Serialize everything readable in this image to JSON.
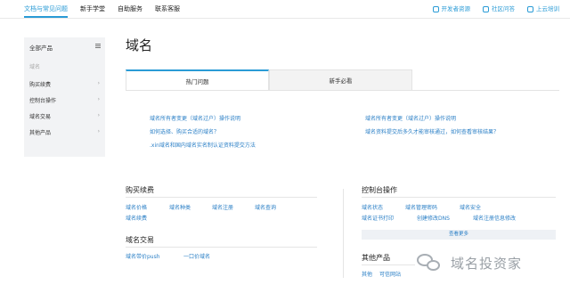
{
  "topbar": {
    "nav": [
      {
        "label": "文档与常见问题",
        "active": true
      },
      {
        "label": "新手学堂",
        "active": false
      },
      {
        "label": "自助服务",
        "active": false
      },
      {
        "label": "联系客服",
        "active": false
      }
    ],
    "links": [
      {
        "label": "开发者资源",
        "icon": "code-icon"
      },
      {
        "label": "社区问答",
        "icon": "chat-icon"
      },
      {
        "label": "上云培训",
        "icon": "training-icon"
      }
    ]
  },
  "sidebar": {
    "header": "全部产品",
    "sub": "域名",
    "items": [
      {
        "label": "购买续费"
      },
      {
        "label": "控制台操作"
      },
      {
        "label": "域名交易"
      },
      {
        "label": "其他产品"
      }
    ],
    "chevron": "›"
  },
  "main": {
    "title": "域名",
    "tabs": [
      {
        "label": "热门问题",
        "active": true
      },
      {
        "label": "新手必看",
        "active": false
      }
    ],
    "questions": {
      "left": [
        "域名所有者变更（域名过户）操作说明",
        "如何选择、购买合适的域名？",
        ".xin域名和国内域名实名制认证资料提交方法"
      ],
      "right": [
        "域名所有者变更（域名过户）操作说明",
        "域名资料提交后多久才能审核通过，如何查看审核结果？"
      ]
    },
    "sections": {
      "buy": {
        "title": "购买续费",
        "links": [
          "域名价格",
          "域名种类",
          "域名注册",
          "域名查询",
          "域名续费"
        ]
      },
      "console": {
        "title": "控制台操作",
        "links": [
          "域名状态",
          "域名管理密码",
          "域名安全",
          "域名证书打印",
          "创建修改DNS",
          "域名注册信息修改"
        ],
        "more": "查看更多"
      },
      "trade": {
        "title": "域名交易",
        "links": [
          "域名带价push",
          "一口价域名"
        ]
      },
      "other": {
        "title": "其他产品",
        "links": [
          "其他",
          "可信网站"
        ]
      }
    }
  },
  "watermark": {
    "text": "域名投资家"
  },
  "colors": {
    "accent": "#2a9bd6",
    "link": "#2a7fc6",
    "sidebar_bg": "#f2f3f5"
  }
}
